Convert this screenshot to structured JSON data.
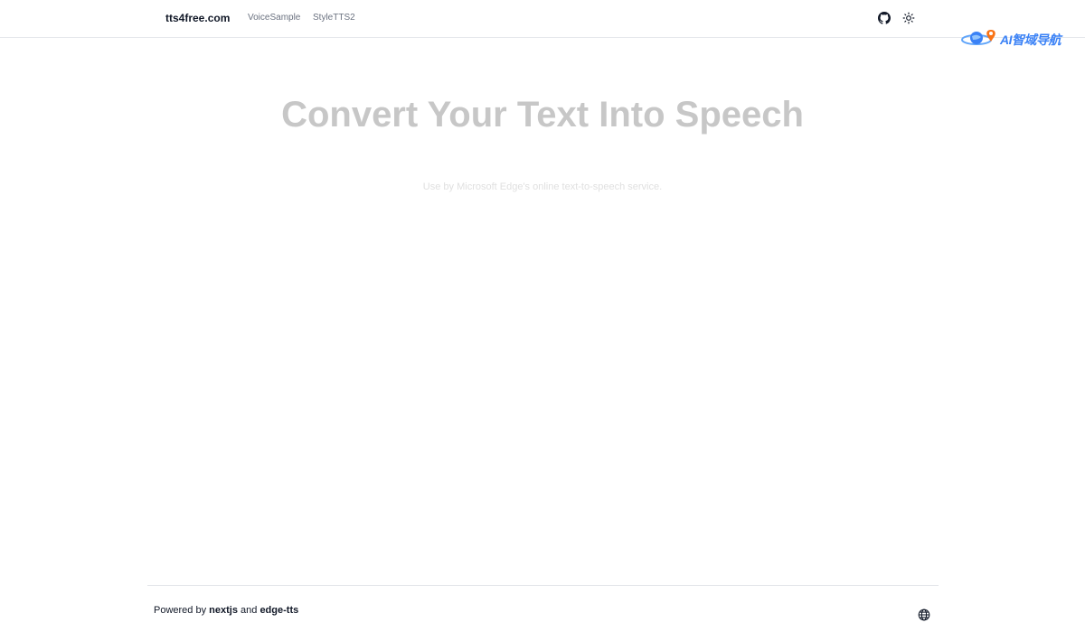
{
  "header": {
    "brand": "tts4free.com",
    "nav": [
      {
        "label": "VoiceSample"
      },
      {
        "label": "StyleTTS2"
      }
    ],
    "icons": {
      "github": "github-icon",
      "theme": "sun-icon"
    }
  },
  "watermark": {
    "text": "AI智域导航"
  },
  "hero": {
    "title": "Convert Your Text Into Speech",
    "subtitle": "Use by Microsoft Edge's online text-to-speech service."
  },
  "footer": {
    "prefix": "Powered by",
    "link1": "nextjs",
    "conjunction": "and",
    "link2": "edge-tts",
    "language_icon": "globe-icon"
  },
  "colors": {
    "title": "#c7c7c7",
    "subtitle": "#e0e0e0",
    "border": "#e5e7eb",
    "nav_text": "#6b7280",
    "watermark_accent": "#3b82f6"
  }
}
